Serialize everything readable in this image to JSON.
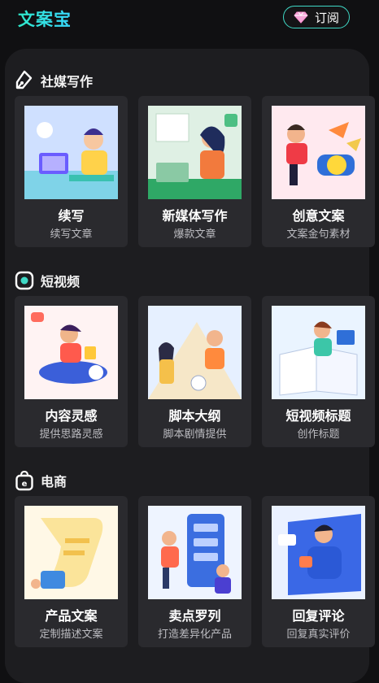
{
  "header": {
    "app_title": "文案宝",
    "subscribe_label": "订阅"
  },
  "sections": [
    {
      "title": "社媒写作",
      "icon": "pen-nib-icon",
      "cards": [
        {
          "title": "续写",
          "subtitle": "续写文章"
        },
        {
          "title": "新媒体写作",
          "subtitle": "爆款文章"
        },
        {
          "title": "创意文案",
          "subtitle": "文案金句素材"
        }
      ]
    },
    {
      "title": "短视频",
      "icon": "record-icon",
      "cards": [
        {
          "title": "内容灵感",
          "subtitle": "提供思路灵感"
        },
        {
          "title": "脚本大纲",
          "subtitle": "脚本剧情提供"
        },
        {
          "title": "短视频标题",
          "subtitle": "创作标题"
        }
      ]
    },
    {
      "title": "电商",
      "icon": "shopping-bag-icon",
      "cards": [
        {
          "title": "产品文案",
          "subtitle": "定制描述文案"
        },
        {
          "title": "卖点罗列",
          "subtitle": "打造差异化产品"
        },
        {
          "title": "回复评论",
          "subtitle": "回复真实评价"
        }
      ]
    }
  ],
  "colors": {
    "accent": "#3fd9c6",
    "background": "#101012",
    "panel": "#1d1d20",
    "card": "#2a2a2e"
  }
}
